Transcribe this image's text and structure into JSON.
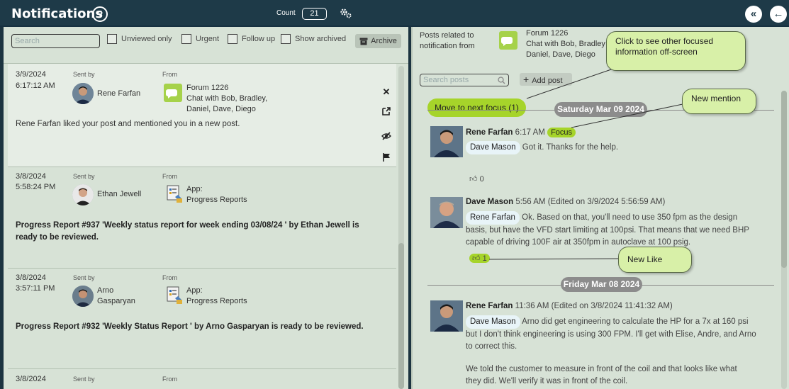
{
  "header": {
    "title": "Notifications",
    "help": "?",
    "count_label": "Count",
    "count_value": "21",
    "collapse_btn": "«",
    "back_btn": "←"
  },
  "filters": {
    "search_placeholder": "Search",
    "unviewed": "Unviewed only",
    "urgent": "Urgent",
    "follow_up": "Follow up",
    "show_archived": "Show archived",
    "archive": "Archive"
  },
  "notifications": [
    {
      "date": "3/9/2024",
      "time": "6:17:12 AM",
      "sent_by_label": "Sent by",
      "sender": "Rene Farfan",
      "from_label": "From",
      "from_lines": [
        "Forum 1226",
        "Chat with Bob, Bradley,",
        "Daniel, Dave, Diego"
      ],
      "body": "Rene Farfan liked your post and mentioned you in a new post."
    },
    {
      "date": "3/8/2024",
      "time": "5:58:24 PM",
      "sent_by_label": "Sent by",
      "sender": "Ethan Jewell",
      "from_label": "From",
      "from_lines": [
        "App:",
        "Progress Reports"
      ],
      "body_line1": "Progress Report #937 'Weekly status report for week ending 03/08/24 ' by Ethan Jewell is",
      "body_line2": "ready to be reviewed."
    },
    {
      "date": "3/8/2024",
      "time": "3:57:11 PM",
      "sent_by_label": "Sent by",
      "sender_line1": "Arno",
      "sender_line2": "Gasparyan",
      "from_label": "From",
      "from_lines": [
        "App:",
        "Progress Reports"
      ],
      "body": "Progress Report #932 'Weekly Status Report ' by Arno Gasparyan is ready to be reviewed."
    },
    {
      "date": "3/8/2024",
      "sent_by_label": "Sent by",
      "from_label": "From"
    }
  ],
  "posts_panel": {
    "header_line1": "Posts related to",
    "header_line2": "notification from",
    "forum_lines": [
      "Forum 1226",
      "Chat with Bob, Bradley",
      "Daniel, Dave, Diego"
    ],
    "search_placeholder": "Search posts",
    "add_post": "Add post",
    "next_focus": "Move to next focus (1)",
    "date1": "Saturday Mar 09 2024",
    "date2": "Friday Mar 08 2024",
    "posts": [
      {
        "name": "Rene Farfan",
        "time": "6:17 AM",
        "badge": "Focus",
        "mention": "Dave Mason",
        "text": "Got it. Thanks for the help.",
        "likes": "0"
      },
      {
        "name": "Dave Mason",
        "time": "5:56 AM",
        "edited": "(Edited on 3/9/2024 5:56:59 AM)",
        "mention": "Rene Farfan",
        "text_line1": "Ok.  Based on that, you'll need to use 350 fpm as the design",
        "text_line2": "basis, but have the VFD start limiting at 100psi.  That means that we need BHP",
        "text_line3": "capable of driving 100F air at 350fpm in autoclave at 100 psig.",
        "likes": "1"
      },
      {
        "name": "Rene Farfan",
        "time": "11:36 AM",
        "edited": "(Edited on 3/8/2024 11:41:32 AM)",
        "mention": "Dave Mason",
        "text_line1": "Arno did get engineering to calculate the HP for a 7x at 160 psi",
        "text_line2": "but I don't think engineering is using 300 FPM. I'll get with Elise, Andre, and Arno",
        "text_line3": "to correct this.",
        "text_line4": "We told the customer to measure in front of the coil and that looks like what",
        "text_line5": "they did. We'll verify it was in front of the coil."
      }
    ]
  },
  "callouts": {
    "focused_line1": "Click to see other focused",
    "focused_line2": "information off-screen",
    "new_mention": "New mention",
    "new_like": "New Like"
  },
  "colors": {
    "header_bg": "#1e3a48",
    "pane_bg": "#d7e2d6",
    "accent_green": "#a6d42a",
    "callout_bg": "#d8f0a8"
  }
}
